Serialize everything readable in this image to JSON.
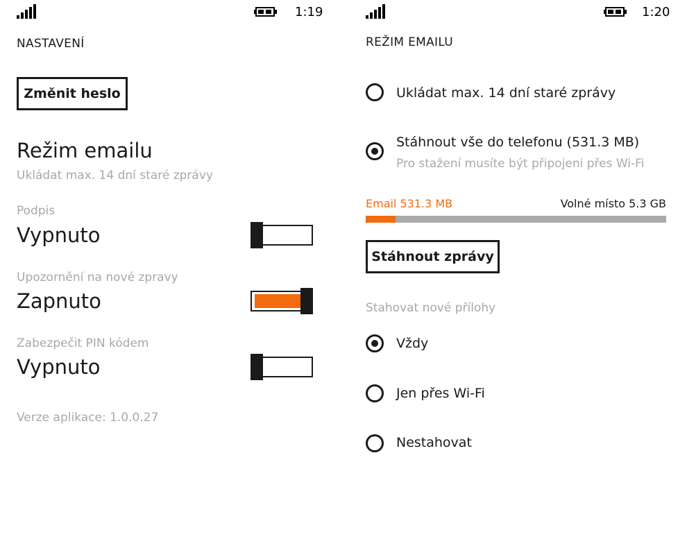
{
  "colors": {
    "accent": "#f26b0f",
    "muted": "#a8a8a8",
    "bar_track": "#aaaaaa"
  },
  "left": {
    "status": {
      "time": "1:19",
      "icons": [
        "signal-icon",
        "battery-charging-icon"
      ]
    },
    "title": "NASTAVENÍ",
    "change_password_label": "Změnit heslo",
    "email_mode": {
      "title": "Režim emailu",
      "value": "Ukládat max. 14 dní staré zprávy"
    },
    "settings": [
      {
        "label": "Podpis",
        "value": "Vypnuto",
        "on": false
      },
      {
        "label": "Upozornění na nové zpravy",
        "value": "Zapnuto",
        "on": true
      },
      {
        "label": "Zabezpečit PIN kódem",
        "value": "Vypnuto",
        "on": false
      }
    ],
    "version": "Verze aplikace: 1.0.0.27"
  },
  "right": {
    "status": {
      "time": "1:20",
      "icons": [
        "signal-icon",
        "battery-charging-icon"
      ]
    },
    "title": "REŽIM EMAILU",
    "mode_options": [
      {
        "label": "Ukládat max. 14 dní staré zprávy",
        "checked": false
      },
      {
        "label": "Stáhnout vše do telefonu (531.3 MB)",
        "sublabel": "Pro stažení musíte být připojeni přes Wi-Fi",
        "checked": true
      }
    ],
    "storage": {
      "email_label": "Email 531.3 MB",
      "free_label": "Volné místo 5.3 GB",
      "used_fraction": 0.1
    },
    "download_label": "Stáhnout zprávy",
    "attachments_label": "Stahovat nové přílohy",
    "attachment_options": [
      {
        "label": "Vždy",
        "checked": true
      },
      {
        "label": "Jen přes Wi-Fi",
        "checked": false
      },
      {
        "label": "Nestahovat",
        "checked": false
      }
    ]
  }
}
